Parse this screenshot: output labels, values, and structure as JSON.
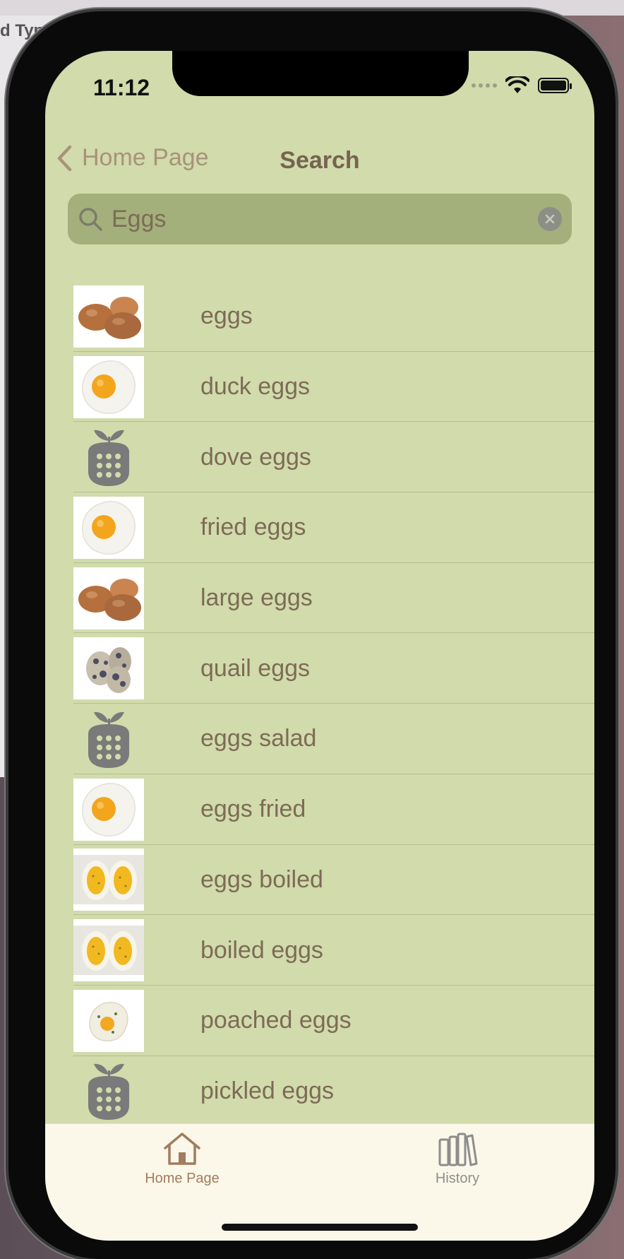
{
  "background": {
    "partial_text": "d Typ"
  },
  "status_bar": {
    "time": "11:12"
  },
  "nav": {
    "back_label": "Home Page",
    "title": "Search"
  },
  "search": {
    "value": "Eggs"
  },
  "results": [
    {
      "label": "eggs",
      "image": "brown-eggs-photo"
    },
    {
      "label": "duck eggs",
      "image": "fried-egg-photo"
    },
    {
      "label": "dove eggs",
      "image": "placeholder-food-icon"
    },
    {
      "label": "fried eggs",
      "image": "fried-egg-photo"
    },
    {
      "label": "large eggs",
      "image": "brown-eggs-photo"
    },
    {
      "label": "quail eggs",
      "image": "quail-eggs-photo"
    },
    {
      "label": "eggs salad",
      "image": "placeholder-food-icon"
    },
    {
      "label": "eggs fried",
      "image": "fried-egg-photo"
    },
    {
      "label": "eggs boiled",
      "image": "boiled-eggs-photo"
    },
    {
      "label": "boiled eggs",
      "image": "boiled-eggs-photo"
    },
    {
      "label": "poached eggs",
      "image": "poached-egg-photo"
    },
    {
      "label": "pickled eggs",
      "image": "placeholder-food-icon"
    }
  ],
  "tabs": [
    {
      "label": "Home Page",
      "icon": "house-icon",
      "active": true,
      "color": "#a17c5e"
    },
    {
      "label": "History",
      "icon": "books-icon",
      "active": false,
      "color": "#8d8d8d"
    }
  ],
  "colors": {
    "screen_bg": "#d1dbab",
    "search_bg": "#a3b07b",
    "text": "#7d6b56",
    "tabbar_bg": "#fbf8ea"
  }
}
